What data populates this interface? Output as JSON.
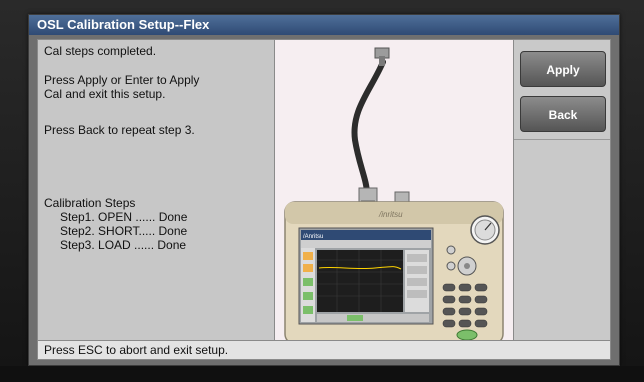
{
  "dialog": {
    "title": "OSL Calibration Setup--Flex"
  },
  "instructions": {
    "line1": "Cal steps completed.",
    "line2a": "Press Apply or Enter to Apply",
    "line2b": "Cal and exit this setup.",
    "line3": "Press Back to repeat step 3.",
    "steps_heading": "Calibration Steps",
    "steps": [
      "Step1. OPEN ...... Done",
      "Step2. SHORT..... Done",
      "Step3. LOAD ...... Done"
    ]
  },
  "buttons": {
    "apply_label": "Apply",
    "back_label": "Back"
  },
  "status": {
    "message": "Press ESC to abort and exit setup."
  },
  "device": {
    "brand": "/inritsu",
    "screen_brand": "/Anritsu"
  },
  "colors": {
    "title_bar": "#3e5d88",
    "panel": "#c7c7c7",
    "image_bg": "#f6eef1",
    "button": "#6f6f6f"
  }
}
